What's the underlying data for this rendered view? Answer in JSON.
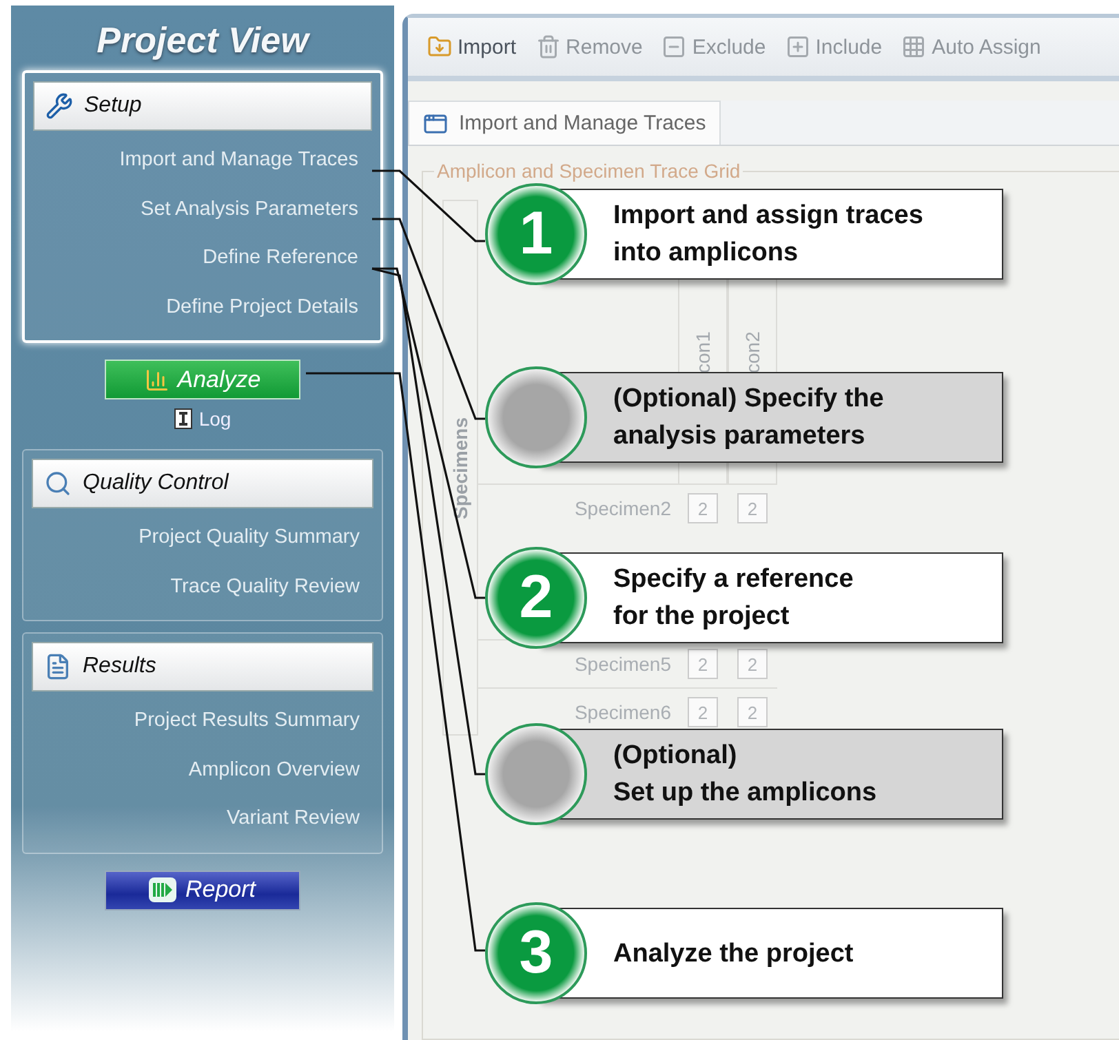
{
  "sidebar": {
    "title": "Project View",
    "sections": [
      {
        "kind": "setup",
        "header": "Setup",
        "items": [
          "Import and Manage Traces",
          "Set Analysis Parameters",
          "Define Reference",
          "Define Project Details"
        ]
      },
      {
        "kind": "quality",
        "header": "Quality Control",
        "items": [
          "Project Quality Summary",
          "Trace Quality Review"
        ]
      },
      {
        "kind": "results",
        "header": "Results",
        "items": [
          "Project Results Summary",
          "Amplicon Overview",
          "Variant Review"
        ]
      }
    ],
    "analyze_button": "Analyze",
    "log_link": "Log",
    "report_button": "Report"
  },
  "toolbar": [
    {
      "label": "Import",
      "disabled": false
    },
    {
      "label": "Remove",
      "disabled": true
    },
    {
      "label": "Exclude",
      "disabled": true
    },
    {
      "label": "Include",
      "disabled": true
    },
    {
      "label": "Auto Assign",
      "disabled": true
    }
  ],
  "tabs": [
    {
      "label": "Import and Manage Traces",
      "selected": true
    }
  ],
  "grid": {
    "title": "Amplicon and Specimen Trace Grid",
    "row_header": "Specimens",
    "columns": [
      "con1",
      "con2"
    ],
    "rows": [
      {
        "name": "Specimen2",
        "cells": [
          "2",
          "2"
        ]
      },
      {
        "name": "Specimen5",
        "cells": [
          "2",
          "2"
        ]
      },
      {
        "name": "Specimen6",
        "cells": [
          "2",
          "2"
        ]
      }
    ]
  },
  "callouts": [
    {
      "kind": "step",
      "number": "1",
      "lines": [
        "Import and assign traces",
        "into amplicons"
      ]
    },
    {
      "kind": "optional",
      "lines": [
        "(Optional) Specify the",
        "analysis parameters"
      ]
    },
    {
      "kind": "step",
      "number": "2",
      "lines": [
        "Specify a reference",
        "for the project"
      ]
    },
    {
      "kind": "optional",
      "lines": [
        "(Optional)",
        "Set up the amplicons"
      ]
    },
    {
      "kind": "step",
      "number": "3",
      "lines": [
        "Analyze the project"
      ]
    }
  ]
}
